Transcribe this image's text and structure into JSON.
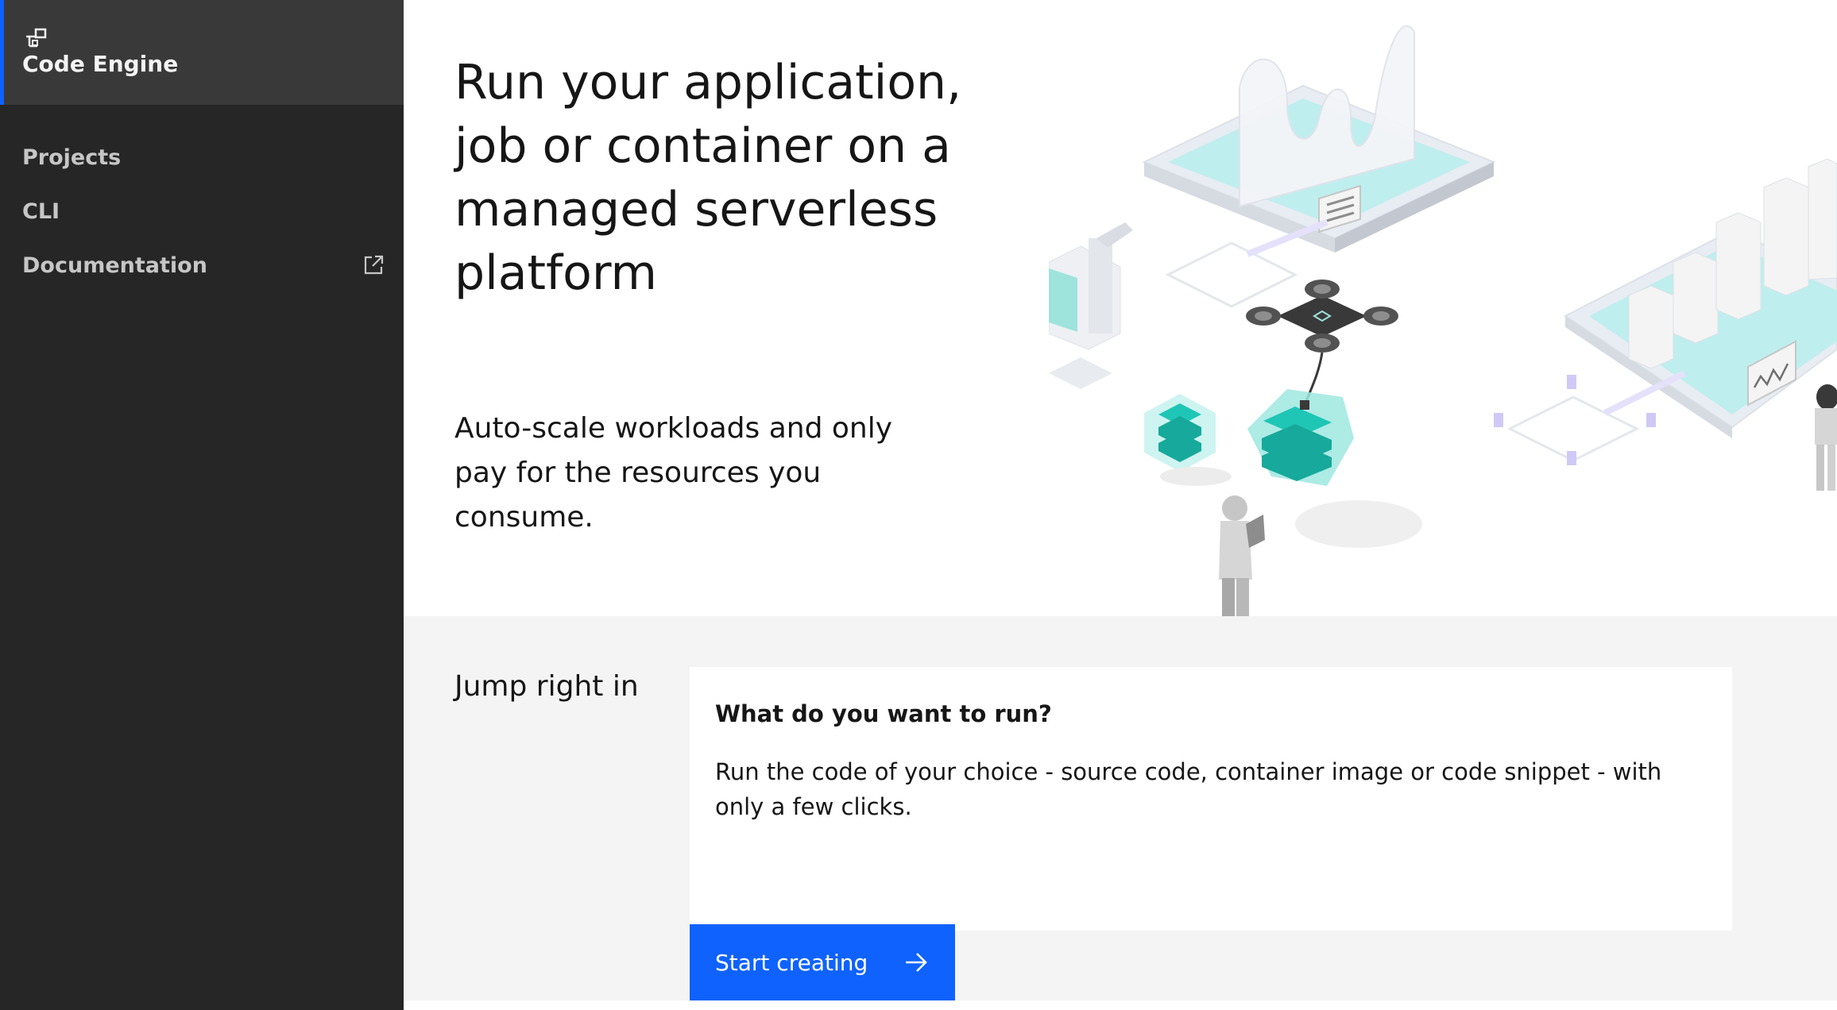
{
  "app": {
    "name": "Code Engine",
    "icon": "code-engine-icon"
  },
  "sidebar": {
    "items": [
      {
        "label": "Projects"
      },
      {
        "label": "CLI"
      },
      {
        "label": "Documentation",
        "icon": "external-link-icon"
      }
    ]
  },
  "hero": {
    "title": "Run your application, job or container on a managed serverless platform",
    "subtitle": "Auto-scale workloads and only pay for the resources you consume."
  },
  "jump": {
    "label": "Jump right in",
    "card": {
      "title": "What do you want to run?",
      "body": "Run the code of your choice - source code, container image or code snippet - with only a few clicks.",
      "button_label": "Start creating",
      "button_icon": "arrow-right-icon"
    }
  },
  "colors": {
    "sidebar_bg": "#262626",
    "sidebar_header_bg": "#393939",
    "accent": "#0f62fe",
    "section_bg": "#f4f4f4",
    "teal": "#1fc6b5"
  }
}
